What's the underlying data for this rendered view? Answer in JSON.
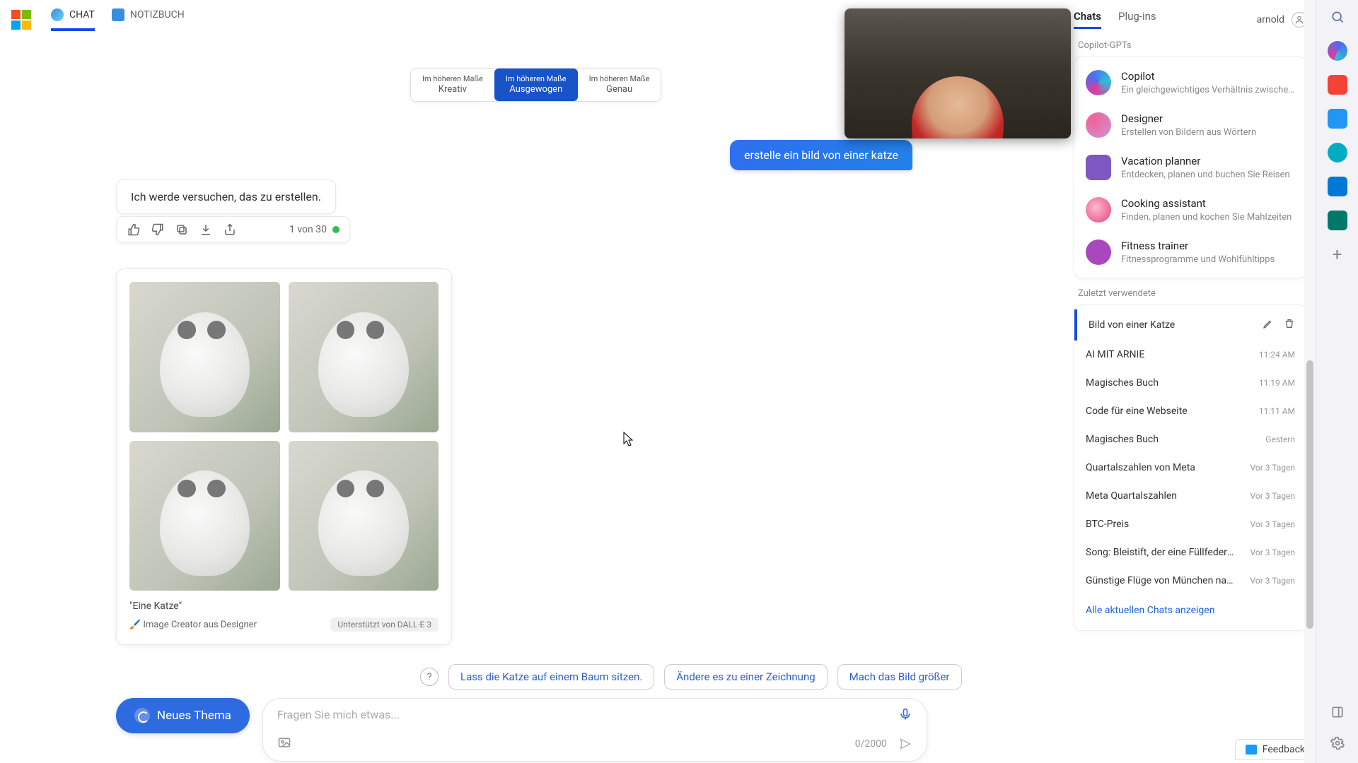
{
  "header": {
    "tabs": [
      {
        "label": "CHAT",
        "active": true
      },
      {
        "label": "NOTIZBUCH",
        "active": false
      }
    ]
  },
  "style_selector": {
    "prefix": "Im höheren Maße",
    "options": [
      "Kreativ",
      "Ausgewogen",
      "Genau"
    ],
    "active_index": 1
  },
  "conversation": {
    "user_message": "erstelle ein bild von einer katze",
    "assistant_message": "Ich werde versuchen, das zu erstellen.",
    "counter": "1 von 30",
    "image_caption": "\"Eine Katze\"",
    "creator_line": "Image Creator aus Designer",
    "dalle_badge": "Unterstützt von DALL·E 3"
  },
  "suggestions": [
    "Lass die Katze auf einem Baum sitzen.",
    "Ändere es zu einer Zeichnung",
    "Mach das Bild größer"
  ],
  "input": {
    "new_topic": "Neues Thema",
    "placeholder": "Fragen Sie mich etwas...",
    "counter": "0/2000"
  },
  "sidebar": {
    "top_tabs": [
      "Chats",
      "Plug-ins"
    ],
    "active_top_tab": 0,
    "user": "arnold",
    "gpts_title": "Copilot-GPTs",
    "gpts": [
      {
        "name": "Copilot",
        "desc": "Ein gleichgewichtiges Verhältnis zwischen KI u",
        "cls": "copilot"
      },
      {
        "name": "Designer",
        "desc": "Erstellen von Bildern aus Wörtern",
        "cls": "designer"
      },
      {
        "name": "Vacation planner",
        "desc": "Entdecken, planen und buchen Sie Reisen",
        "cls": "vacation"
      },
      {
        "name": "Cooking assistant",
        "desc": "Finden, planen und kochen Sie Mahlzeiten",
        "cls": "cooking"
      },
      {
        "name": "Fitness trainer",
        "desc": "Fitnessprogramme und Wohlfühltipps",
        "cls": "fitness"
      }
    ],
    "recents_title": "Zuletzt verwendete",
    "recents": [
      {
        "title": "Bild von einer Katze",
        "time": "",
        "active": true
      },
      {
        "title": "AI MIT ARNIE",
        "time": "11:24 AM"
      },
      {
        "title": "Magisches Buch",
        "time": "11:19 AM"
      },
      {
        "title": "Code für eine Webseite",
        "time": "11:11 AM"
      },
      {
        "title": "Magisches Buch",
        "time": "Gestern"
      },
      {
        "title": "Quartalszahlen von Meta",
        "time": "Vor 3 Tagen"
      },
      {
        "title": "Meta Quartalszahlen",
        "time": "Vor 3 Tagen"
      },
      {
        "title": "BTC-Preis",
        "time": "Vor 3 Tagen"
      },
      {
        "title": "Song: Bleistift, der eine Füllfeder sein m",
        "time": "Vor 3 Tagen"
      },
      {
        "title": "Günstige Flüge von München nach Fra",
        "time": "Vor 3 Tagen"
      }
    ],
    "show_all": "Alle aktuellen Chats anzeigen"
  },
  "feedback": "Feedback"
}
